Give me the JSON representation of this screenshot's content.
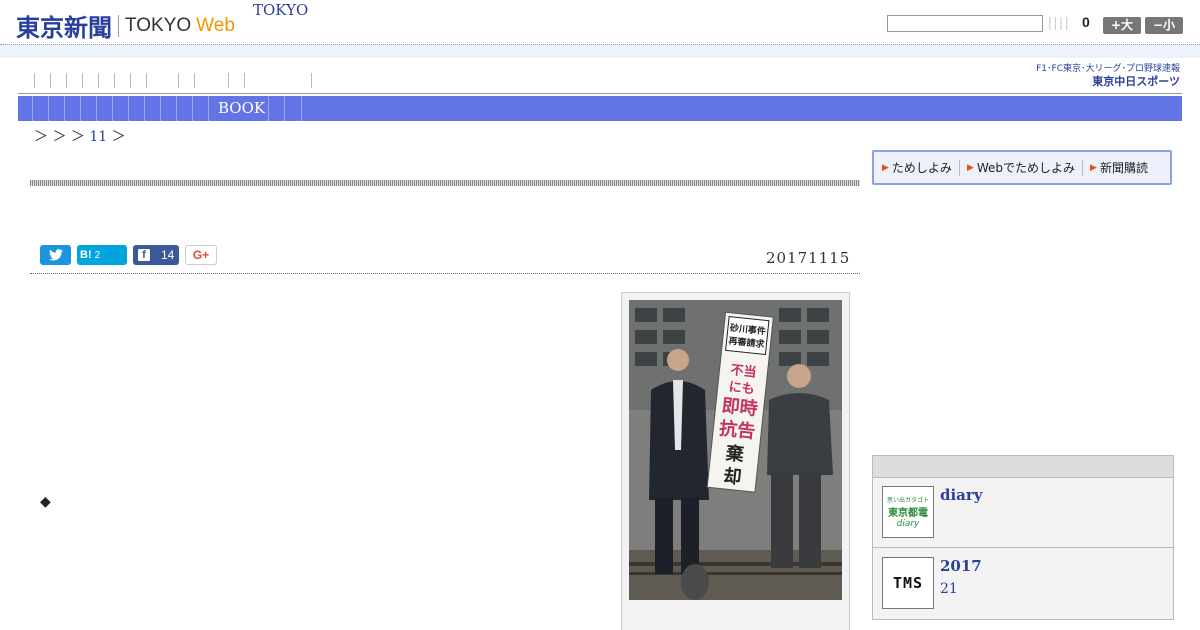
{
  "header": {
    "logo_jp": "東京新聞",
    "logo_en": "TOKYO",
    "logo_web": "Web",
    "count": "0",
    "font_larger_label": "+大",
    "font_smaller_label": "−小"
  },
  "nav": {
    "primary_label": "TOKYO",
    "secondary_label": "BOOK",
    "chunichi_top": "F1･FC東京･大リーグ･プロ野球速報",
    "chunichi_bottom": "東京中日スポーツ"
  },
  "breadcrumb": {
    "prefix": "＞ ＞ ＞",
    "link": "11",
    "suffix": "＞"
  },
  "subscription": {
    "items": [
      "ためしよみ",
      "Webでためしよみ",
      "新聞購読"
    ]
  },
  "social": {
    "hatena_label": "B!",
    "hatena_count": "2",
    "facebook_count": "14",
    "gplus_label": "G+"
  },
  "article": {
    "date": "20171115",
    "bullet": "◆"
  },
  "photo": {
    "banner_top": "砂川事件再審請求",
    "banner_main": "不当にも即時抗告棄却"
  },
  "sidebar": {
    "items": [
      {
        "title": "diary",
        "subtitle": "",
        "thumb_top": "思い出ガタゴト",
        "thumb_main": "東京都電",
        "thumb_sub": "diary"
      },
      {
        "title": "2017",
        "subtitle": "21",
        "thumb_top": "",
        "thumb_main": "TMS",
        "thumb_sub": ""
      }
    ]
  },
  "colors": {
    "brand_blue": "#2a3f9b",
    "nav_bar": "#6374e6",
    "web_orange": "#f29600"
  }
}
